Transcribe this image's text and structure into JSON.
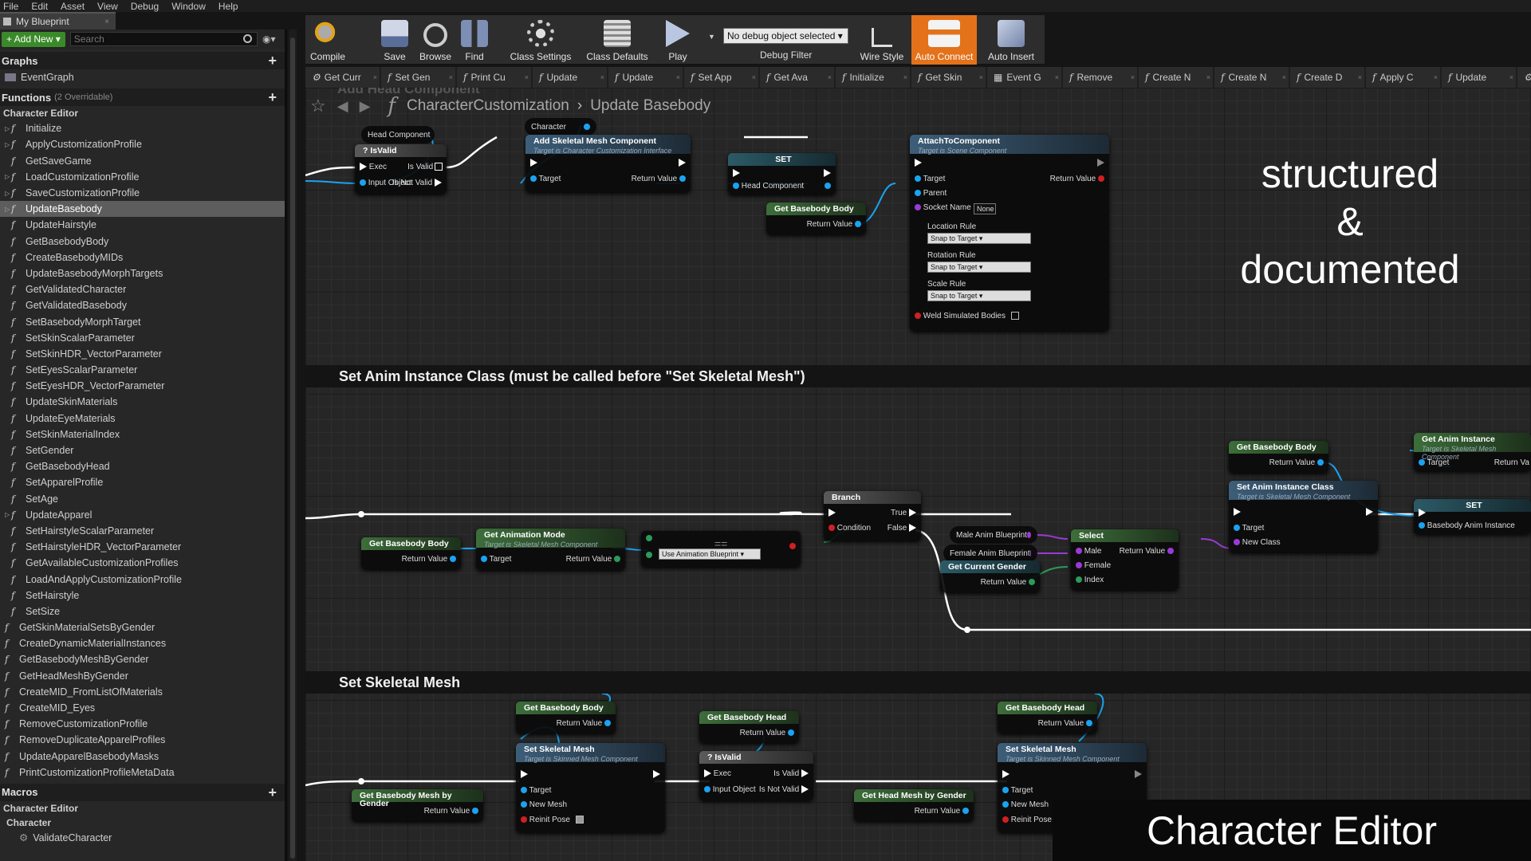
{
  "menu": [
    "File",
    "Edit",
    "Asset",
    "View",
    "Debug",
    "Window",
    "Help"
  ],
  "window_tab": {
    "title": "My Blueprint",
    "close": "×"
  },
  "sidebar": {
    "add_new": "+ Add New ▾",
    "search_placeholder": "Search",
    "graphs_header": "Graphs",
    "graphs": [
      "EventGraph"
    ],
    "functions_header": "Functions",
    "functions_sub": "(2 Overridable)",
    "category": "Character Editor",
    "functions": [
      "Initialize",
      "ApplyCustomizationProfile",
      "GetSaveGame",
      "LoadCustomizationProfile",
      "SaveCustomizationProfile",
      "UpdateBasebody",
      "UpdateHairstyle",
      "GetBasebodyBody",
      "CreateBasebodyMIDs",
      "UpdateBasebodyMorphTargets",
      "GetValidatedCharacter",
      "GetValidatedBasebody",
      "SetBasebodyMorphTarget",
      "SetSkinScalarParameter",
      "SetSkinHDR_VectorParameter",
      "SetEyesScalarParameter",
      "SetEyesHDR_VectorParameter",
      "UpdateSkinMaterials",
      "UpdateEyeMaterials",
      "SetSkinMaterialIndex",
      "SetGender",
      "GetBasebodyHead",
      "SetApparelProfile",
      "SetAge",
      "UpdateApparel",
      "SetHairstyleScalarParameter",
      "SetHairstyleHDR_VectorParameter",
      "GetAvailableCustomizationProfiles",
      "LoadAndApplyCustomizationProfile",
      "SetHairstyle",
      "SetSize"
    ],
    "extra_functions": [
      "GetSkinMaterialSetsByGender",
      "CreateDynamicMaterialInstances",
      "GetBasebodyMeshByGender",
      "GetHeadMeshByGender",
      "CreateMID_FromListOfMaterials",
      "CreateMID_Eyes",
      "RemoveCustomizationProfile",
      "RemoveDuplicateApparelProfiles",
      "UpdateApparelBasebodyMasks",
      "PrintCustomizationProfileMetaData"
    ],
    "macros_header": "Macros",
    "macro_category": "Character Editor",
    "macro_sub": "Character",
    "macro_item": "ValidateCharacter"
  },
  "toolbar": {
    "compile": "Compile",
    "save": "Save",
    "browse": "Browse",
    "find": "Find",
    "class_settings": "Class Settings",
    "class_defaults": "Class Defaults",
    "play": "Play",
    "debug_select": "No debug object selected ▾",
    "debug_filter": "Debug Filter",
    "wire_style": "Wire Style",
    "auto_connect": "Auto Connect",
    "auto_insert": "Auto Insert",
    "accent": "#e3721b"
  },
  "tabs": [
    "Get Curr",
    "Set Gen",
    "Print Cu",
    "Update",
    "Update",
    "Set App",
    "Get Ava",
    "Initialize",
    "Get Skin",
    "Event G",
    "Remove",
    "Create N",
    "Create N",
    "Create D",
    "Apply C",
    "Update",
    "V"
  ],
  "breadcrumb": {
    "ghost": "Add Head Component",
    "part1": "CharacterCustomization",
    "part2": "Update Basebody"
  },
  "comments": {
    "anim": "Set Anim Instance Class (must be called before \"Set Skeletal Mesh\")",
    "mesh": "Set Skeletal Mesh"
  },
  "nodes": {
    "head_component": "Head Component",
    "isvalid": "? IsValid",
    "exec": "Exec",
    "is_valid": "Is Valid",
    "input_object": "Input Object",
    "is_not_valid": "Is Not Valid",
    "character": "Character",
    "add_skel": "Add Skeletal Mesh Component",
    "add_skel_sub": "Target is Character Customization Interface",
    "target": "Target",
    "return_value": "Return Value",
    "set": "SET",
    "head_comp_pin": "Head Component",
    "get_basebody_body": "Get Basebody Body",
    "attach": "AttachToComponent",
    "attach_sub": "Target is Scene Component",
    "parent": "Parent",
    "socket_name": "Socket Name",
    "none": "None",
    "location_rule": "Location Rule",
    "rotation_rule": "Rotation Rule",
    "scale_rule": "Scale Rule",
    "snap": "Snap to Target ▾",
    "weld": "Weld Simulated Bodies",
    "branch": "Branch",
    "condition": "Condition",
    "true": "True",
    "false": "False",
    "get_anim_mode": "Get Animation Mode",
    "skel_mesh_sub": "Target is Skeletal Mesh Component",
    "use_anim_bp": "Use Animation Blueprint ▾",
    "eq": "==",
    "male_bp": "Male Anim Blueprint",
    "female_bp": "Female Anim Blueprint",
    "get_gender": "Get Current Gender",
    "select": "Select",
    "male": "Male",
    "female": "Female",
    "index": "Index",
    "set_anim_class": "Set Anim Instance Class",
    "new_class": "New Class",
    "get_anim_inst": "Get Anim Instance",
    "basebody_anim": "Basebody Anim Instance",
    "return_va": "Return Va",
    "get_basebody_head": "Get Basebody Head",
    "set_skel_mesh": "Set Skeletal Mesh",
    "skinned_sub": "Target is Skinned Mesh Component",
    "new_mesh": "New Mesh",
    "reinit": "Reinit Pose",
    "mesh_by_gender": "Get Basebody Mesh by Gender",
    "head_by_gender": "Get Head Mesh by Gender"
  },
  "overlay": {
    "line1": "structured",
    "line2": "&",
    "line3": "documented",
    "watermark": "Character Editor"
  }
}
